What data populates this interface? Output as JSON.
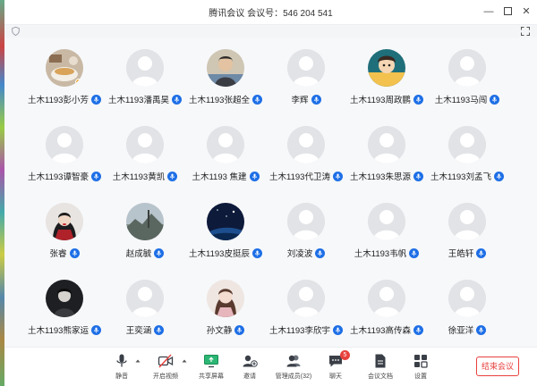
{
  "window": {
    "title": "腾讯会议  会议号：546 204 541"
  },
  "colors": {
    "accent": "#1e6fe6",
    "end": "#e8413d",
    "badge": "#f5a623"
  },
  "participants": [
    {
      "name": "土木1193彭小芳",
      "avatar": "photo-bowl",
      "badge": true
    },
    {
      "name": "土木1193潘禹昊",
      "avatar": "default"
    },
    {
      "name": "土木1193张超全",
      "avatar": "photo-person"
    },
    {
      "name": "李辉",
      "avatar": "default"
    },
    {
      "name": "土木1193周政鹏",
      "avatar": "photo-cartoon"
    },
    {
      "name": "土木1193马闯",
      "avatar": "default"
    },
    {
      "name": "土木1193谭智豪",
      "avatar": "default"
    },
    {
      "name": "土木1193黄凯",
      "avatar": "default"
    },
    {
      "name": "土木1193 焦建",
      "avatar": "default"
    },
    {
      "name": "土木1193代卫涛",
      "avatar": "default"
    },
    {
      "name": "土木1193朱思源",
      "avatar": "default"
    },
    {
      "name": "土木1193刘孟飞",
      "avatar": "default"
    },
    {
      "name": "张睿",
      "avatar": "photo-girl-red"
    },
    {
      "name": "赵成毓",
      "avatar": "photo-landscape"
    },
    {
      "name": "土木1193皮挺辰",
      "avatar": "photo-night"
    },
    {
      "name": "刘凌波",
      "avatar": "default"
    },
    {
      "name": "土木1193韦帆",
      "avatar": "default"
    },
    {
      "name": "王皓轩",
      "avatar": "default"
    },
    {
      "name": "土木1193熊家运",
      "avatar": "photo-dark"
    },
    {
      "name": "王奕涵",
      "avatar": "default"
    },
    {
      "name": "孙文静",
      "avatar": "photo-girl"
    },
    {
      "name": "土木1193李欣宇",
      "avatar": "default"
    },
    {
      "name": "土木1193高传森",
      "avatar": "default"
    },
    {
      "name": "徐亚洋",
      "avatar": "default"
    }
  ],
  "toolbar": {
    "mute": "静音",
    "video": "开启视频",
    "share": "共享屏幕",
    "invite": "邀请",
    "members": "管理成员(32)",
    "chat": "聊天",
    "chat_unread": "5",
    "docs": "会议文档",
    "settings": "设置",
    "end": "结束会议"
  }
}
